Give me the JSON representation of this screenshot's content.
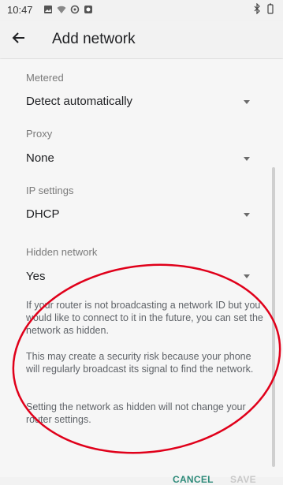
{
  "status_bar": {
    "time": "10:47"
  },
  "app_bar": {
    "title": "Add network"
  },
  "fields": {
    "metered": {
      "label": "Metered",
      "value": "Detect automatically"
    },
    "proxy": {
      "label": "Proxy",
      "value": "None"
    },
    "ip_settings": {
      "label": "IP settings",
      "value": "DHCP"
    },
    "hidden_network": {
      "label": "Hidden network",
      "value": "Yes"
    }
  },
  "info": {
    "p1": "If your router is not broadcasting a network ID but you would like to connect to it in the future, you can set the network as hidden.",
    "p2": "This may create a security risk because your phone will regularly broadcast its signal to find the network.",
    "p3": "Setting the network as hidden will not change your router settings."
  },
  "buttons": {
    "cancel": "CANCEL",
    "save": "SAVE"
  },
  "colors": {
    "accent": "#2e8b7a",
    "annotation": "#e0001a"
  }
}
